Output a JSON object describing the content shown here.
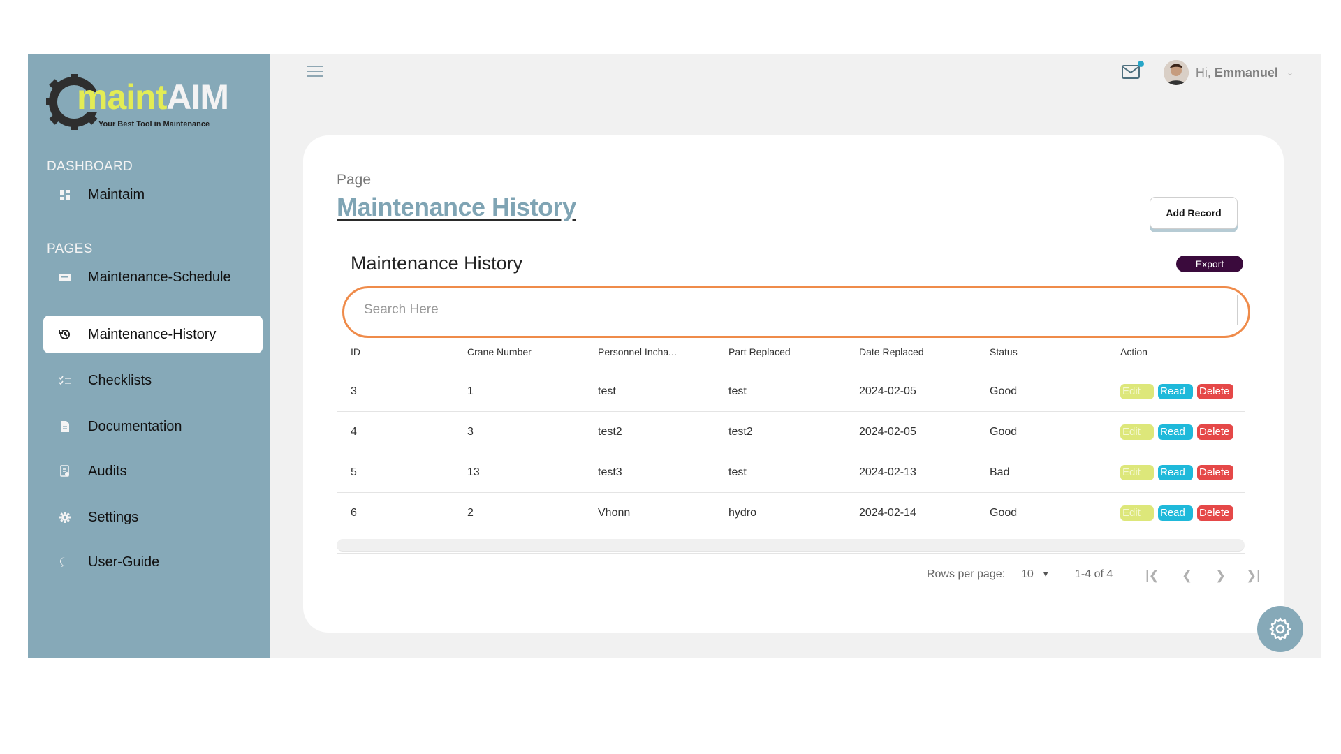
{
  "brand": {
    "logo_main": "maintAIM",
    "logo_m": "maint",
    "logo_aim": "AIM",
    "tagline": "Your Best Tool in Maintenance"
  },
  "sidebar": {
    "sections": [
      "DASHBOARD",
      "PAGES"
    ],
    "items": [
      {
        "label": "Maintaim",
        "icon": "dashboard-icon"
      },
      {
        "label": "Maintenance-Schedule",
        "icon": "calendar-icon"
      },
      {
        "label": "Maintenance-History",
        "icon": "history-icon",
        "active": true
      },
      {
        "label": "Checklists",
        "icon": "checklist-icon"
      },
      {
        "label": "Documentation",
        "icon": "document-icon"
      },
      {
        "label": "Audits",
        "icon": "audit-icon"
      },
      {
        "label": "Settings",
        "icon": "gear-icon"
      },
      {
        "label": "User-Guide",
        "icon": "chat-icon"
      }
    ]
  },
  "topbar": {
    "greeting": "Hi,",
    "user_name": "Emmanuel"
  },
  "page": {
    "crumb": "Page",
    "title": "Maintenance History",
    "add_record_label": "Add Record"
  },
  "table": {
    "title": "Maintenance History",
    "export_label": "Export",
    "search_placeholder": "Search Here",
    "columns": [
      "ID",
      "Crane Number",
      "Personnel Incha...",
      "Part Replaced",
      "Date Replaced",
      "Status",
      "Action"
    ],
    "rows": [
      [
        "3",
        "1",
        "test",
        "test",
        "2024-02-05",
        "Good"
      ],
      [
        "4",
        "3",
        "test2",
        "test2",
        "2024-02-05",
        "Good"
      ],
      [
        "5",
        "13",
        "test3",
        "test",
        "2024-02-13",
        "Bad"
      ],
      [
        "6",
        "2",
        "Vhonn",
        "hydro",
        "2024-02-14",
        "Good"
      ]
    ],
    "actions": {
      "edit": "Edit",
      "read": "Read",
      "delete": "Delete"
    }
  },
  "pagination": {
    "rows_per_page_label": "Rows per page:",
    "rows_per_page": "10",
    "range": "1-4 of 4"
  },
  "colors": {
    "sidebar": "#86a9b8",
    "accent_orange": "#ef8b4a",
    "export": "#3a0a3c",
    "edit": "#dde77a",
    "read": "#1fb9da",
    "delete": "#e54848"
  }
}
